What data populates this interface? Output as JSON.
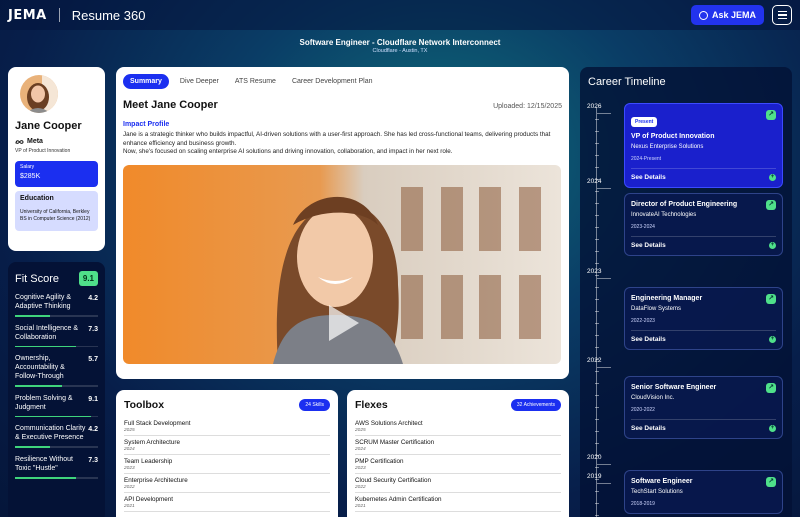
{
  "header": {
    "logo": "JEMA",
    "app_name": "Resume 360",
    "ask_label": "Ask JEMA"
  },
  "job": {
    "title": "Software Engineer - Cloudflare Network Interconnect",
    "location": "Cloudflare - Austin, TX"
  },
  "profile": {
    "name": "Jane Cooper",
    "company": "Meta",
    "role": "VP of Product Innovation",
    "salary_label": "Salary",
    "salary_value": "$285K",
    "education_label": "Education",
    "education_school": "University of California, Berkley",
    "education_degree": "BS in Computer Science (2012)"
  },
  "fit_score": {
    "title": "Fit Score",
    "score": "9.1",
    "metrics": [
      {
        "label": "Cognitive Agility & Adaptive Thinking",
        "value": "4.2",
        "fill": 0.42
      },
      {
        "label": "Social Intelligence & Collaboration",
        "value": "7.3",
        "fill": 0.73
      },
      {
        "label": "Ownership, Accountability & Follow-Through",
        "value": "5.7",
        "fill": 0.57
      },
      {
        "label": "Problem Solving & Judgment",
        "value": "9.1",
        "fill": 0.91
      },
      {
        "label": "Communication Clarity & Executive Presence",
        "value": "4.2",
        "fill": 0.42
      },
      {
        "label": "Resilience Without Toxic \"Hustle\"",
        "value": "7.3",
        "fill": 0.73
      }
    ]
  },
  "main": {
    "tabs": [
      "Summary",
      "Dive Deeper",
      "ATS Resume",
      "Career Development Plan"
    ],
    "heading": "Meet Jane Cooper",
    "uploaded": "Uploaded: 12/15/2025",
    "impact_heading": "Impact Profile",
    "impact_text": "Jane is a strategic thinker who builds impactful, AI-driven solutions with a user-first approach. She has led cross-functional teams, delivering products that enhance efficiency and business growth.",
    "impact_text2": "Now, she's focused on scaling enterprise AI solutions and driving innovation, collaboration, and impact in her next role."
  },
  "toolbox": {
    "title": "Toolbox",
    "badge": "24 Skills",
    "items": [
      {
        "name": "Full Stack Development",
        "year": "2025"
      },
      {
        "name": "System Architecture",
        "year": "2024"
      },
      {
        "name": "Team Leadership",
        "year": "2023"
      },
      {
        "name": "Enterprise Architecture",
        "year": "2022"
      },
      {
        "name": "API Development",
        "year": "2021"
      }
    ]
  },
  "flexes": {
    "title": "Flexes",
    "badge": "32 Achievements",
    "items": [
      {
        "name": "AWS Solutions Architect",
        "year": "2025"
      },
      {
        "name": "SCRUM Master Certification",
        "year": "2024"
      },
      {
        "name": "PMP Certification",
        "year": "2023"
      },
      {
        "name": "Cloud Security Certification",
        "year": "2022"
      },
      {
        "name": "Kubernetes Admin Certification",
        "year": "2021"
      }
    ]
  },
  "timeline": {
    "title": "Career Timeline",
    "years": [
      "2026",
      "2024",
      "2023",
      "2022",
      "2020",
      "2019"
    ],
    "present_label": "Present",
    "see_details": "See Details",
    "cards": [
      {
        "title": "VP of Product Innovation",
        "company": "Nexus Enterprise Solutions",
        "dates": "2024-Present"
      },
      {
        "title": "Director of Product Engineering",
        "company": "InnovateAI Technologies",
        "dates": "2023-2024"
      },
      {
        "title": "Engineering Manager",
        "company": "DataFlow Systems",
        "dates": "2022-2023"
      },
      {
        "title": "Senior Software Engineer",
        "company": "CloudVision Inc.",
        "dates": "2020-2022"
      },
      {
        "title": "Software Engineer",
        "company": "TechStart Solutions",
        "dates": "2018-2019"
      }
    ]
  }
}
